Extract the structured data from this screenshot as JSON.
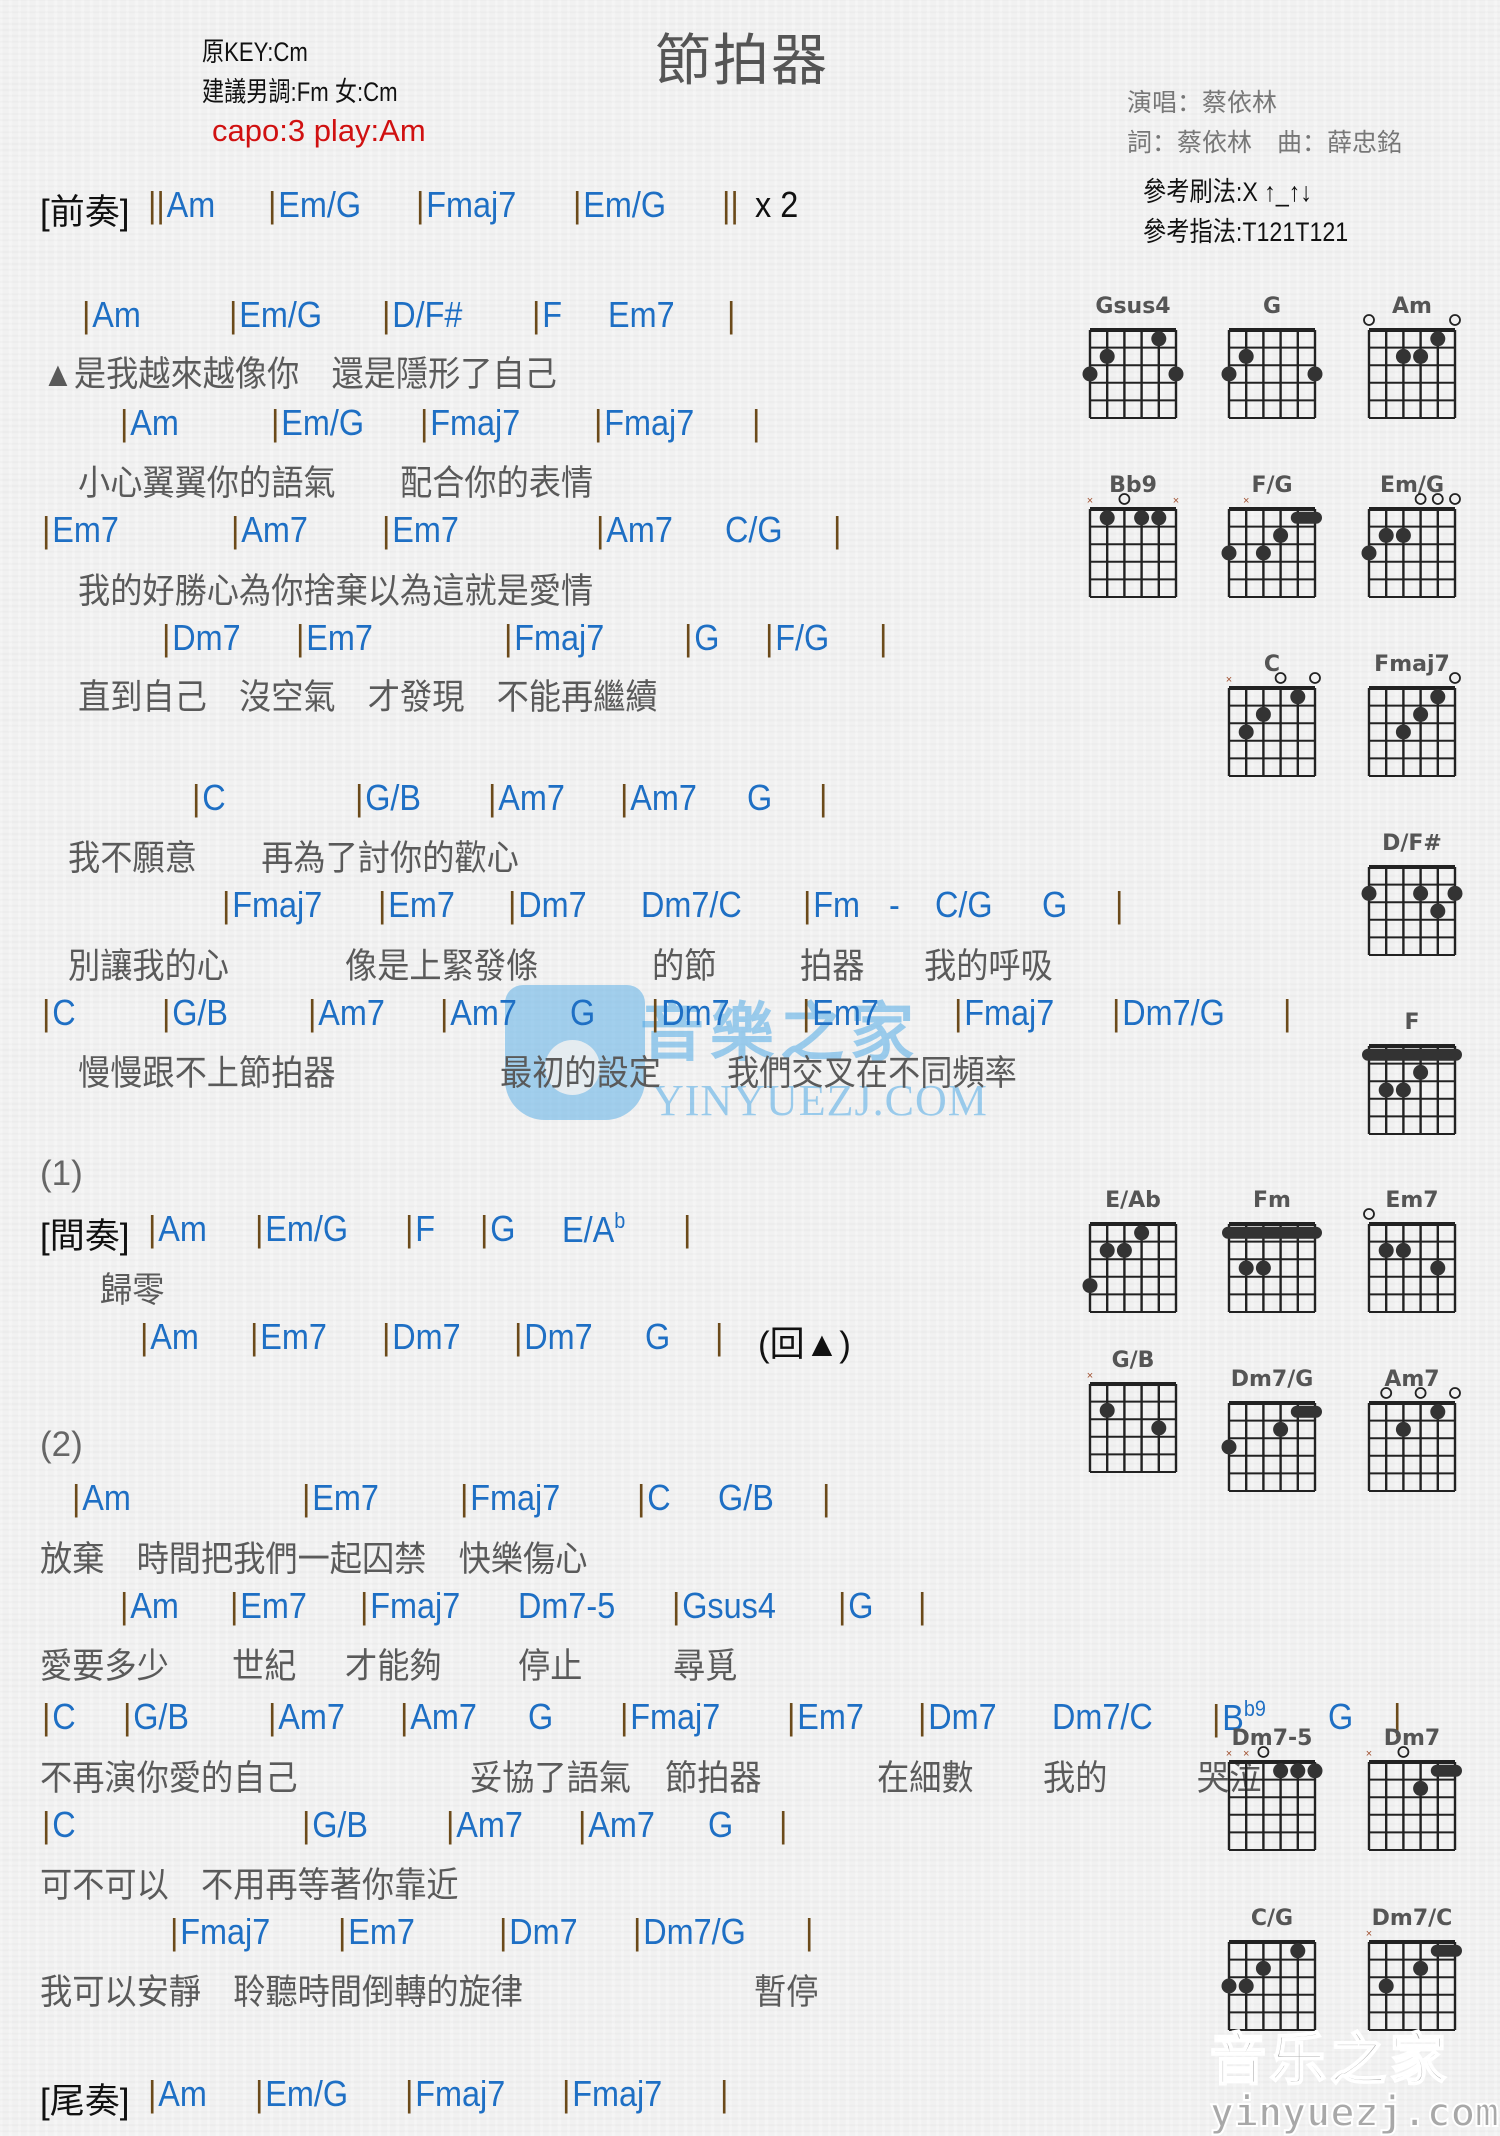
{
  "header": {
    "title": "節拍器",
    "original_key": "原KEY:Cm",
    "suggested_key": "建議男調:Fm 女:Cm",
    "capo": "capo:3 play:Am",
    "singer": "演唱：蔡依林",
    "credits": "詞：蔡依林　曲：薛忠銘",
    "strum": "參考刷法:X ↑_↑↓",
    "picking": "參考指法:T121T121"
  },
  "colors": {
    "chord": "#1e6fc4",
    "lyric": "#5a5a5a",
    "capo": "#d01010",
    "barline": "#6b4a1a"
  },
  "sheet": {
    "prelude": {
      "tag": "[前奏]",
      "chords": [
        "||Am",
        "|Em/G",
        "|Fmaj7",
        "|Em/G",
        "||",
        "x 2"
      ]
    },
    "verse1": [
      {
        "chords": [
          "|Am",
          "|Em/G",
          "|D/F#",
          "|F",
          "Em7",
          "|"
        ],
        "lyric": "▲是我越來越像你　還是隱形了自己"
      },
      {
        "chords": [
          "|Am",
          "|Em/G",
          "|Fmaj7",
          "|Fmaj7",
          "|"
        ],
        "lyric": "小心翼翼你的語氣　　配合你的表情"
      },
      {
        "chords": [
          "|Em7",
          "|Am7",
          "|Em7",
          "|Am7",
          "C/G",
          "|"
        ],
        "lyric": "我的好勝心為你捨棄以為這就是愛情"
      },
      {
        "chords": [
          "|Dm7",
          "|Em7",
          "|Fmaj7",
          "|G",
          "|F/G",
          "|"
        ],
        "lyric": "直到自己　沒空氣　才發現　不能再繼續"
      }
    ],
    "chorus1": [
      {
        "chords": [
          "|C",
          "|G/B",
          "|Am7",
          "|Am7",
          "G",
          "|"
        ],
        "lyric": "我不願意　　再為了討你的歡心"
      },
      {
        "chords": [
          "|Fmaj7",
          "|Em7",
          "|Dm7",
          "Dm7/C",
          "|Fm",
          "-",
          "C/G",
          "G",
          "|"
        ],
        "lyric_parts": [
          "別讓我的心",
          "像是上緊發條",
          "的節",
          "拍器",
          "我的呼吸"
        ]
      },
      {
        "chords": [
          "|C",
          "|G/B",
          "|Am7",
          "|Am7",
          "G",
          "|Dm7",
          "|Em7",
          "|Fmaj7",
          "|Dm7/G",
          "|"
        ],
        "lyric_parts": [
          "慢慢跟不上節拍器",
          "最初的設定",
          "我們交叉在不同頻率"
        ]
      }
    ],
    "part1": {
      "label": "(1)",
      "interlude_tag": "[間奏]",
      "interlude_chords": [
        "|Am",
        "|Em/G",
        "|F",
        "|G",
        "E/A",
        "b",
        "|"
      ],
      "interlude_lyric": "歸零",
      "return_chords": [
        "|Am",
        "|Em7",
        "|Dm7",
        "|Dm7",
        "G",
        "|"
      ],
      "return_mark": "(回▲)"
    },
    "part2": {
      "label": "(2)",
      "lines": [
        {
          "chords": [
            "|Am",
            "|Em7",
            "|Fmaj7",
            "|C",
            "G/B",
            "|"
          ],
          "lyric": "放棄　時間把我們一起囚禁　快樂傷心"
        },
        {
          "chords": [
            "|Am",
            "|Em7",
            "|Fmaj7",
            "Dm7-5",
            "|Gsus4",
            "|G",
            "|"
          ],
          "lyric_parts": [
            "愛要多少",
            "世紀",
            "才能夠",
            "停止",
            "尋覓"
          ]
        },
        {
          "chords": [
            "|C",
            "|G/B",
            "|Am7",
            "|Am7",
            "G",
            "|Fmaj7",
            "|Em7",
            "|Dm7",
            "Dm7/C",
            "|B",
            "b9",
            "G",
            "|"
          ],
          "lyric_parts": [
            "不再演你愛的自己",
            "妥協了語氣",
            "節拍器",
            "在細數",
            "我的",
            "哭泣"
          ]
        },
        {
          "chords": [
            "|C",
            "|G/B",
            "|Am7",
            "|Am7",
            "G",
            "|"
          ],
          "lyric": "可不可以　不用再等著你靠近"
        },
        {
          "chords": [
            "|Fmaj7",
            "|Em7",
            "|Dm7",
            "|Dm7/G",
            "|"
          ],
          "lyric_parts": [
            "我可以安靜　聆聽時間倒轉的旋律",
            "暫停"
          ]
        }
      ]
    },
    "outro": {
      "tag": "[尾奏]",
      "chords": [
        "|Am",
        "|Em/G",
        "|Fmaj7",
        "|Fmaj7",
        "|"
      ]
    }
  },
  "chord_diagrams": [
    {
      "name": "Gsus4",
      "muted": [],
      "open": [],
      "dots": [
        [
          1,
          3
        ],
        [
          2,
          2
        ],
        [
          6,
          3
        ],
        [
          5,
          1
        ]
      ],
      "barre": null
    },
    {
      "name": "G",
      "muted": [],
      "open": [],
      "dots": [
        [
          1,
          3
        ],
        [
          2,
          2
        ],
        [
          6,
          3
        ]
      ],
      "barre": null
    },
    {
      "name": "Am",
      "muted": [],
      "open": [
        1,
        6
      ],
      "dots": [
        [
          3,
          2
        ],
        [
          4,
          2
        ],
        [
          5,
          1
        ]
      ],
      "barre": null
    },
    {
      "name": "Bb9",
      "muted": [
        1,
        6
      ],
      "open": [
        3
      ],
      "dots": [
        [
          2,
          1
        ],
        [
          4,
          1
        ],
        [
          5,
          1
        ]
      ],
      "barre": null
    },
    {
      "name": "F/G",
      "muted": [
        2
      ],
      "open": [],
      "dots": [
        [
          1,
          3
        ],
        [
          3,
          3
        ],
        [
          4,
          2
        ]
      ],
      "barre": [
        5,
        6,
        1
      ]
    },
    {
      "name": "Em/G",
      "muted": [],
      "open": [
        4,
        5,
        6
      ],
      "dots": [
        [
          1,
          3
        ],
        [
          2,
          2
        ],
        [
          3,
          2
        ]
      ],
      "barre": null
    },
    {
      "name": "C",
      "muted": [
        1
      ],
      "open": [
        4,
        6
      ],
      "dots": [
        [
          2,
          3
        ],
        [
          3,
          2
        ],
        [
          5,
          1
        ]
      ],
      "barre": null
    },
    {
      "name": "Fmaj7",
      "muted": [],
      "open": [
        6
      ],
      "dots": [
        [
          3,
          3
        ],
        [
          4,
          2
        ],
        [
          5,
          1
        ]
      ],
      "barre": null
    },
    {
      "name": "D/F#",
      "muted": [],
      "open": [],
      "dots": [
        [
          1,
          2
        ],
        [
          4,
          2
        ],
        [
          6,
          2
        ],
        [
          5,
          3
        ]
      ],
      "barre": null
    },
    {
      "name": "F",
      "muted": [],
      "open": [],
      "dots": [
        [
          2,
          3
        ],
        [
          3,
          3
        ],
        [
          4,
          2
        ]
      ],
      "barre": [
        1,
        6,
        1
      ]
    },
    {
      "name": "E/Ab",
      "muted": [],
      "open": [],
      "dots": [
        [
          1,
          4
        ],
        [
          2,
          2
        ],
        [
          3,
          2
        ],
        [
          4,
          1
        ]
      ],
      "barre": null
    },
    {
      "name": "Fm",
      "muted": [],
      "open": [],
      "dots": [
        [
          2,
          3
        ],
        [
          3,
          3
        ]
      ],
      "barre": [
        1,
        6,
        1
      ]
    },
    {
      "name": "Em7",
      "muted": [],
      "open": [
        1
      ],
      "dots": [
        [
          2,
          2
        ],
        [
          3,
          2
        ],
        [
          5,
          3
        ]
      ],
      "barre": null
    },
    {
      "name": "G/B",
      "muted": [
        1
      ],
      "open": [],
      "dots": [
        [
          2,
          2
        ],
        [
          5,
          3
        ]
      ],
      "barre": null
    },
    {
      "name": "Dm7/G",
      "muted": [],
      "open": [],
      "dots": [
        [
          1,
          3
        ],
        [
          4,
          2
        ]
      ],
      "barre": [
        5,
        6,
        1
      ]
    },
    {
      "name": "Am7",
      "muted": [],
      "open": [
        2,
        4,
        6
      ],
      "dots": [
        [
          3,
          2
        ],
        [
          5,
          1
        ]
      ],
      "barre": null
    },
    {
      "name": "Dm7-5",
      "muted": [
        1,
        2
      ],
      "open": [
        3
      ],
      "dots": [
        [
          4,
          1
        ],
        [
          5,
          1
        ],
        [
          6,
          1
        ]
      ],
      "barre": null
    },
    {
      "name": "Dm7",
      "muted": [
        1
      ],
      "open": [
        3
      ],
      "dots": [
        [
          4,
          2
        ]
      ],
      "barre": [
        5,
        6,
        1
      ]
    },
    {
      "name": "C/G",
      "muted": [],
      "open": [],
      "dots": [
        [
          1,
          3
        ],
        [
          2,
          3
        ],
        [
          3,
          2
        ],
        [
          5,
          1
        ]
      ],
      "barre": null
    },
    {
      "name": "Dm7/C",
      "muted": [
        1
      ],
      "open": [],
      "dots": [
        [
          2,
          3
        ],
        [
          4,
          2
        ]
      ],
      "barre": [
        5,
        6,
        1
      ]
    }
  ],
  "watermarks": {
    "center_cn": "音樂之家",
    "center_en": "YINYUEZJ.COM",
    "corner_cn": "音乐之家",
    "corner_en": "yinyuezj.com"
  }
}
